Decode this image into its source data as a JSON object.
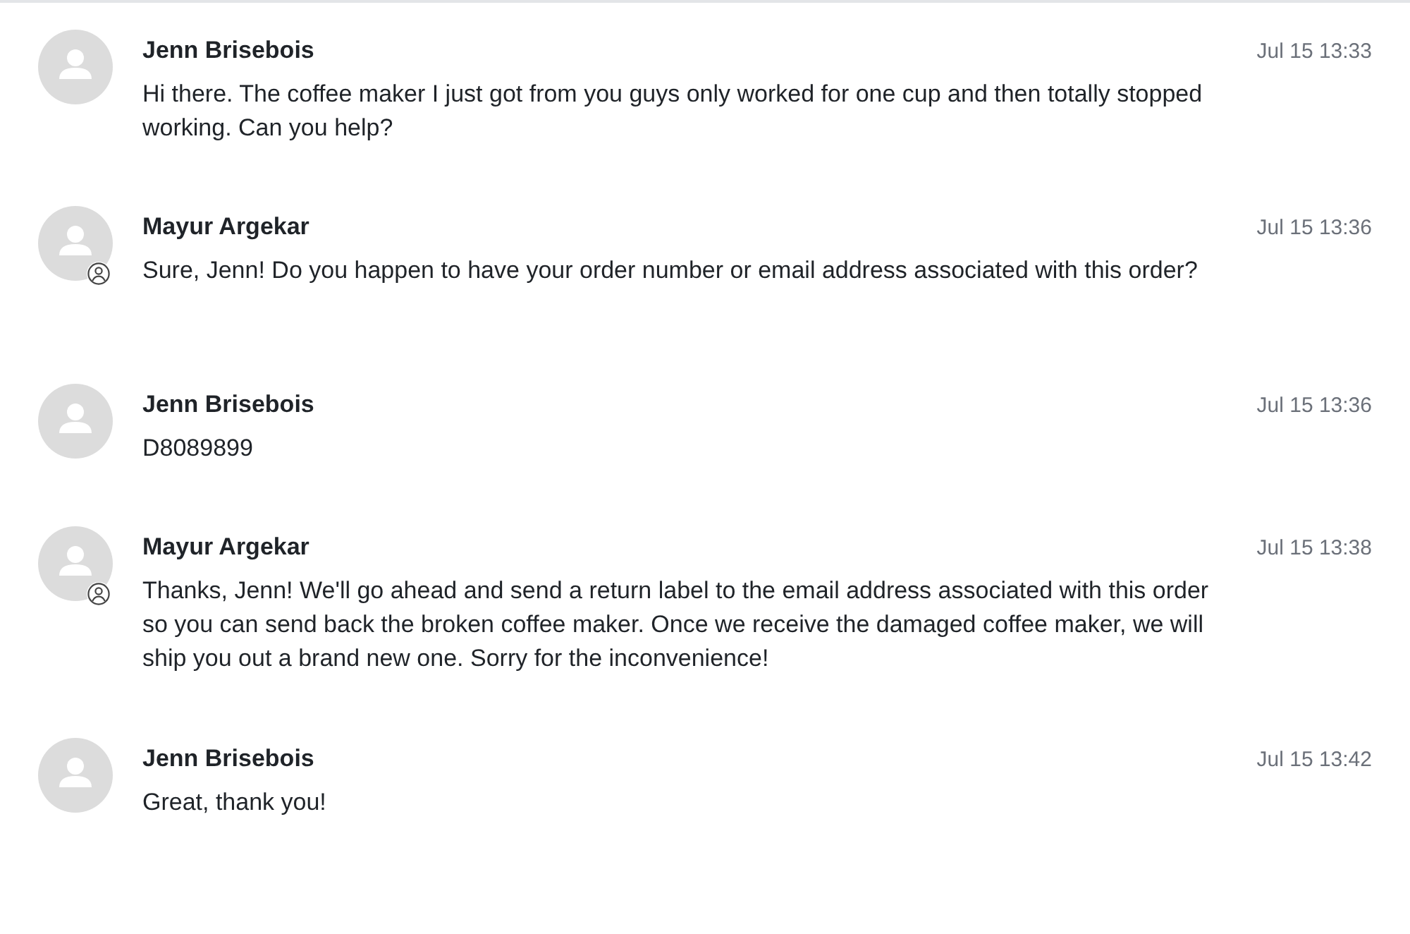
{
  "messages": [
    {
      "kind": "customer",
      "author": "Jenn Brisebois",
      "time": "Jul 15 13:33",
      "text": "Hi there. The coffee maker I just got from you guys only worked for one cup and then totally stopped\nworking. Can you help?"
    },
    {
      "kind": "agent",
      "author": "Mayur Argekar",
      "time": "Jul 15 13:36",
      "text": "Sure, Jenn! Do you happen to have your order number or email address associated with this order?"
    },
    {
      "kind": "customer",
      "author": "Jenn Brisebois",
      "time": "Jul 15 13:36",
      "text": "D8089899"
    },
    {
      "kind": "agent",
      "author": "Mayur Argekar",
      "time": "Jul 15 13:38",
      "text": "Thanks, Jenn! We'll go ahead and send a return label to the email address associated with this order\nso you can send back the broken coffee maker. Once we receive the damaged coffee maker, we will\nship you out a brand new one. Sorry for the inconvenience!"
    },
    {
      "kind": "customer",
      "author": "Jenn Brisebois",
      "time": "Jul 15 13:42",
      "text": "Great, thank you!"
    }
  ]
}
